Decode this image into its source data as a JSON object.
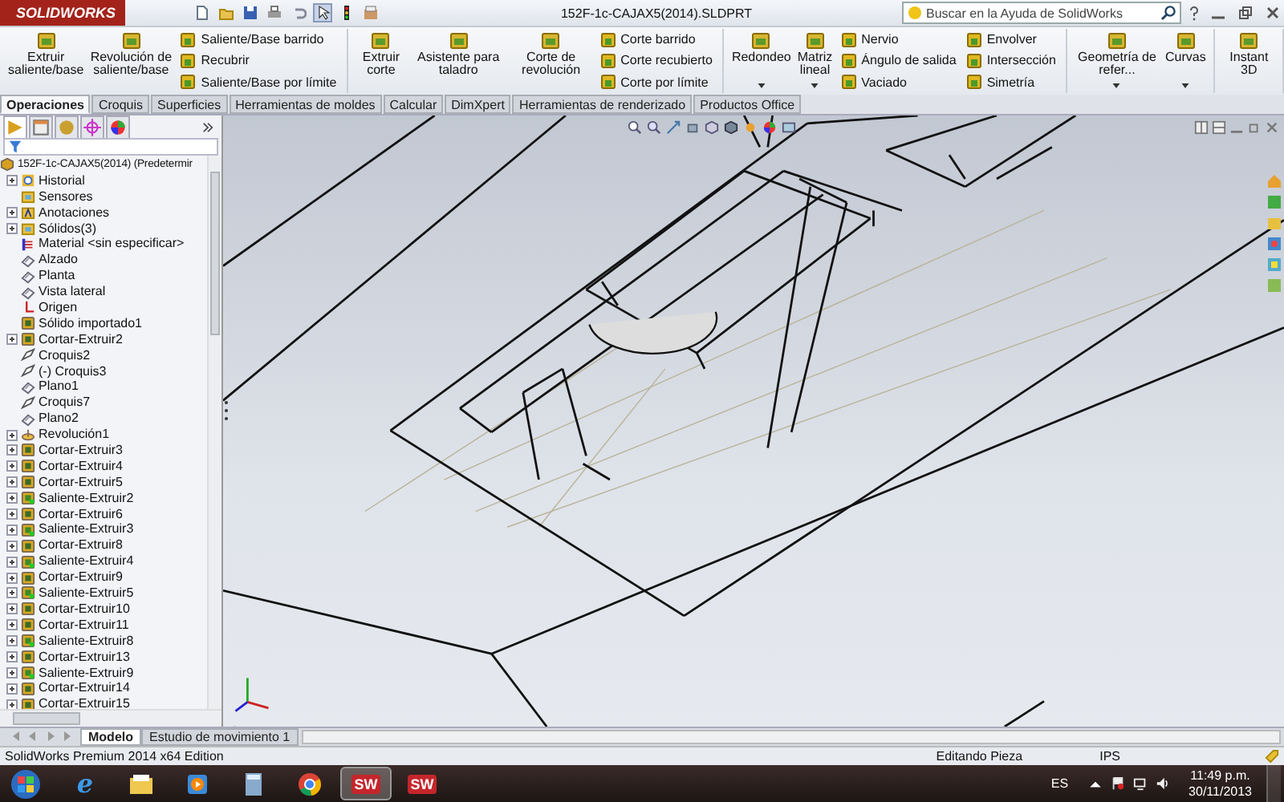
{
  "title_bar": {
    "logo": "SOLIDWORKS",
    "title": "152F-1c-CAJAX5(2014).SLDPRT",
    "search": {
      "placeholder": "Buscar en la Ayuda de SolidWorks"
    }
  },
  "ribbon": {
    "groups": [
      {
        "large": [
          {
            "label": "Extruir saliente/base",
            "dropdown": false
          },
          {
            "label": "Revolución de saliente/base",
            "dropdown": false
          }
        ],
        "small_columns": [
          [
            "Saliente/Base barrido",
            "Recubrir",
            "Saliente/Base por límite"
          ]
        ]
      },
      {
        "large": [
          {
            "label": "Extruir corte",
            "dropdown": false
          },
          {
            "label": "Asistente para taladro",
            "dropdown": false
          },
          {
            "label": "Corte de revolución",
            "dropdown": false
          }
        ],
        "small_columns": [
          [
            "Corte barrido",
            "Corte recubierto",
            "Corte por límite"
          ]
        ]
      },
      {
        "large": [
          {
            "label": "Redondeo",
            "dropdown": true
          },
          {
            "label": "Matriz lineal",
            "dropdown": true
          }
        ],
        "small_columns": [
          [
            "Nervio",
            "Ángulo de salida",
            "Vaciado"
          ],
          [
            "Envolver",
            "Intersección",
            "Simetría"
          ]
        ]
      },
      {
        "large": [
          {
            "label": "Geometría de refer...",
            "dropdown": true
          },
          {
            "label": "Curvas",
            "dropdown": true
          }
        ]
      },
      {
        "large": [
          {
            "label": "Instant 3D",
            "dropdown": false
          }
        ]
      }
    ]
  },
  "tabs": [
    {
      "label": "Operaciones",
      "selected": true
    },
    {
      "label": "Croquis",
      "selected": false
    },
    {
      "label": "Superficies",
      "selected": false
    },
    {
      "label": "Herramientas de moldes",
      "selected": false
    },
    {
      "label": "Calcular",
      "selected": false
    },
    {
      "label": "DimXpert",
      "selected": false
    },
    {
      "label": "Herramientas de renderizado",
      "selected": false
    },
    {
      "label": "Productos Office",
      "selected": false
    }
  ],
  "feature_tree": {
    "root": "152F-1c-CAJAX5(2014)  (Predetermir",
    "children": [
      {
        "label": "Historial",
        "kind": "history",
        "expandable": true
      },
      {
        "label": "Sensores",
        "kind": "folder",
        "expandable": false
      },
      {
        "label": "Anotaciones",
        "kind": "annotations",
        "expandable": true
      },
      {
        "label": "Sólidos(3)",
        "kind": "folder",
        "expandable": true
      },
      {
        "label": "Material <sin especificar>",
        "kind": "material",
        "expandable": false
      },
      {
        "label": "Alzado",
        "kind": "plane",
        "expandable": false
      },
      {
        "label": "Planta",
        "kind": "plane",
        "expandable": false
      },
      {
        "label": "Vista lateral",
        "kind": "plane",
        "expandable": false
      },
      {
        "label": "Origen",
        "kind": "origin",
        "expandable": false
      },
      {
        "label": "Sólido importado1",
        "kind": "cut",
        "expandable": false
      },
      {
        "label": "Cortar-Extruir2",
        "kind": "cut",
        "expandable": true
      },
      {
        "label": "Croquis2",
        "kind": "sketch",
        "expandable": false
      },
      {
        "label": "(-) Croquis3",
        "kind": "sketch",
        "expandable": false
      },
      {
        "label": "Plano1",
        "kind": "plane",
        "expandable": false
      },
      {
        "label": "Croquis7",
        "kind": "sketch",
        "expandable": false
      },
      {
        "label": "Plano2",
        "kind": "plane",
        "expandable": false
      },
      {
        "label": "Revolución1",
        "kind": "revolve",
        "expandable": true
      },
      {
        "label": "Cortar-Extruir3",
        "kind": "cut",
        "expandable": true
      },
      {
        "label": "Cortar-Extruir4",
        "kind": "cut",
        "expandable": true
      },
      {
        "label": "Cortar-Extruir5",
        "kind": "cut",
        "expandable": true
      },
      {
        "label": "Saliente-Extruir2",
        "kind": "boss",
        "expandable": true
      },
      {
        "label": "Cortar-Extruir6",
        "kind": "cut",
        "expandable": true
      },
      {
        "label": "Saliente-Extruir3",
        "kind": "boss",
        "expandable": true
      },
      {
        "label": "Cortar-Extruir8",
        "kind": "cut",
        "expandable": true
      },
      {
        "label": "Saliente-Extruir4",
        "kind": "boss",
        "expandable": true
      },
      {
        "label": "Cortar-Extruir9",
        "kind": "cut",
        "expandable": true
      },
      {
        "label": "Saliente-Extruir5",
        "kind": "boss",
        "expandable": true
      },
      {
        "label": "Cortar-Extruir10",
        "kind": "cut",
        "expandable": true
      },
      {
        "label": "Cortar-Extruir11",
        "kind": "cut",
        "expandable": true
      },
      {
        "label": "Saliente-Extruir8",
        "kind": "boss",
        "expandable": true
      },
      {
        "label": "Cortar-Extruir13",
        "kind": "cut",
        "expandable": true
      },
      {
        "label": "Saliente-Extruir9",
        "kind": "boss",
        "expandable": true
      },
      {
        "label": "Cortar-Extruir14",
        "kind": "cut",
        "expandable": true
      },
      {
        "label": "Cortar-Extruir15",
        "kind": "cut",
        "expandable": true
      }
    ]
  },
  "bottom_tabs": [
    {
      "label": "Modelo",
      "selected": true
    },
    {
      "label": "Estudio de movimiento 1",
      "selected": false
    }
  ],
  "status_bar": {
    "edition": "SolidWorks Premium 2014 x64 Edition",
    "mode": "Editando Pieza",
    "units": "IPS"
  },
  "taskbar": {
    "apps": [
      {
        "kind": "ie",
        "selected": false,
        "label": "e"
      },
      {
        "kind": "explorer",
        "selected": false
      },
      {
        "kind": "media",
        "selected": false
      },
      {
        "kind": "calculator",
        "selected": false
      },
      {
        "kind": "chrome",
        "selected": false
      },
      {
        "kind": "solidworks",
        "selected": true,
        "label": "SW"
      },
      {
        "kind": "solidworks",
        "selected": false,
        "label": "SW"
      }
    ],
    "language": "ES",
    "time": "11:49 p.m.",
    "date": "30/11/2013"
  }
}
